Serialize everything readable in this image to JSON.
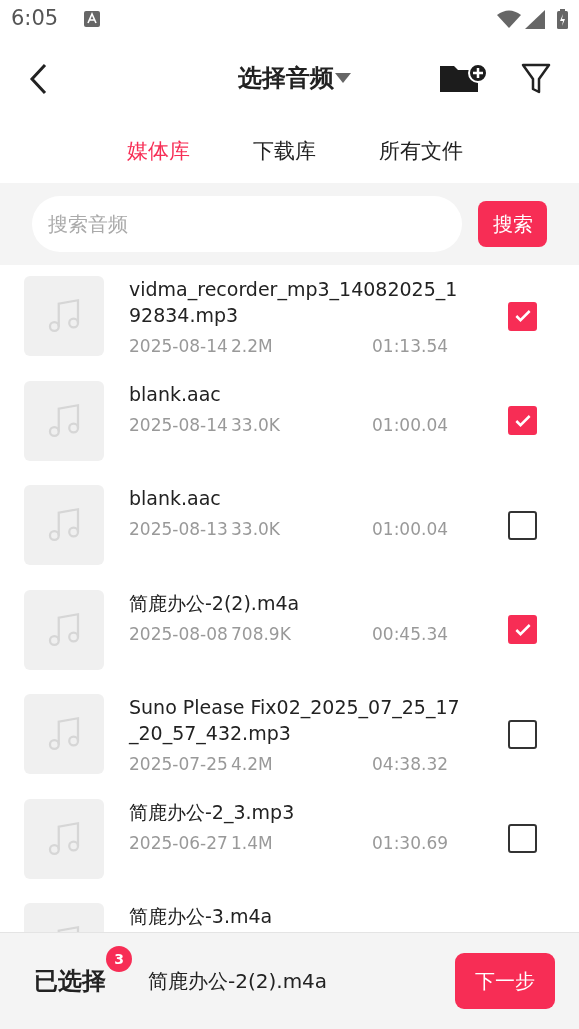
{
  "status_bar": {
    "time": "6:05"
  },
  "header": {
    "title": "选择音频"
  },
  "tabs": [
    {
      "label": "媒体库",
      "selected": true
    },
    {
      "label": "下载库",
      "selected": false
    },
    {
      "label": "所有文件",
      "selected": false
    }
  ],
  "search": {
    "placeholder": "搜索音频",
    "button": "搜索"
  },
  "files": [
    {
      "name": "vidma_recorder_mp3_14082025_192834.mp3",
      "date": "2025-08-14",
      "size": "2.2M",
      "duration": "01:13.54",
      "checked": true
    },
    {
      "name": "blank.aac",
      "date": "2025-08-14",
      "size": "33.0K",
      "duration": "01:00.04",
      "checked": true
    },
    {
      "name": "blank.aac",
      "date": "2025-08-13",
      "size": "33.0K",
      "duration": "01:00.04",
      "checked": false
    },
    {
      "name": "简鹿办公-2(2).m4a",
      "date": "2025-08-08",
      "size": "708.9K",
      "duration": "00:45.34",
      "checked": true
    },
    {
      "name": "Suno Please Fix02_2025_07_25_17_20_57_432.mp3",
      "date": "2025-07-25",
      "size": "4.2M",
      "duration": "04:38.32",
      "checked": false
    },
    {
      "name": "简鹿办公-2_3.mp3",
      "date": "2025-06-27",
      "size": "1.4M",
      "duration": "01:30.69",
      "checked": false
    },
    {
      "name": "简鹿办公-3.m4a"
    }
  ],
  "footer": {
    "label": "已选择",
    "count": "3",
    "current": "简鹿办公-2(2).m4a",
    "next": "下一步"
  }
}
